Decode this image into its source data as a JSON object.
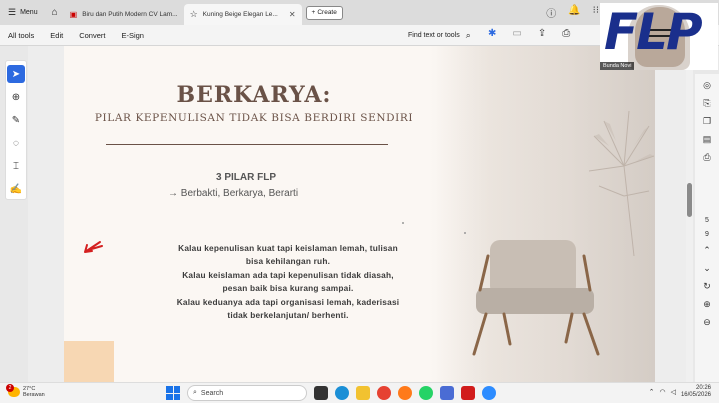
{
  "browser": {
    "menu_label": "Menu",
    "tabs": [
      {
        "label": "Biru dan Putih Modern CV Lam..."
      },
      {
        "label": "Kuning Beige Elegan Le..."
      }
    ],
    "create_label": "Create"
  },
  "toolbar": {
    "items": [
      "All tools",
      "Edit",
      "Convert",
      "E-Sign"
    ],
    "find_label": "Find text or tools"
  },
  "webcam": {
    "logo_text": "FLP",
    "participant_name": "Bunda Novi"
  },
  "slide": {
    "title": "BERKARYA:",
    "subtitle": "PILAR KEPENULISAN TIDAK BISA BERDIRI SENDIRI",
    "pilar_heading": "3 PILAR FLP",
    "pilar_list": "→ Berbakti, Berkarya, Berarti",
    "body_lines": [
      "Kalau kepenulisan kuat tapi keislaman lemah, tulisan",
      "bisa kehilangan ruh.",
      "Kalau keislaman ada tapi kepenulisan tidak diasah,",
      "pesan baik bisa kurang sampai.",
      "Kalau keduanya ada tapi organisasi lemah, kaderisasi",
      "tidak berkelanjutan/ berhenti."
    ]
  },
  "right_panel": {
    "page_number": "5",
    "page_total": "9"
  },
  "taskbar": {
    "weather_temp": "27°C",
    "weather_desc": "Berawan",
    "weather_badge": "2",
    "search_label": "Search",
    "time": "20:26",
    "date": "16/05/2026"
  },
  "colors": {
    "title_brown": "#6a5247",
    "accent_blue": "#2d6ae0",
    "flp_blue": "#1a2f8c",
    "pen_red": "#d42020"
  }
}
